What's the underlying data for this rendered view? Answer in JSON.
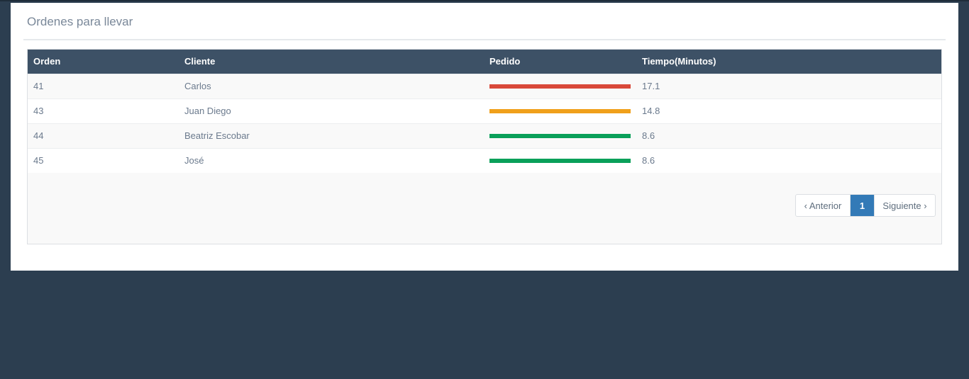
{
  "panel": {
    "title": "Ordenes para llevar"
  },
  "table": {
    "headers": [
      "Orden",
      "Cliente",
      "Pedido",
      "Tiempo(Minutos)"
    ],
    "rows": [
      {
        "orden": "41",
        "cliente": "Carlos",
        "pedido_color": "#d9493a",
        "tiempo": "17.1"
      },
      {
        "orden": "43",
        "cliente": "Juan Diego",
        "pedido_color": "#f0a01b",
        "tiempo": "14.8"
      },
      {
        "orden": "44",
        "cliente": "Beatriz Escobar",
        "pedido_color": "#0aa05a",
        "tiempo": "8.6"
      },
      {
        "orden": "45",
        "cliente": "José",
        "pedido_color": "#0aa05a",
        "tiempo": "8.6"
      }
    ]
  },
  "pagination": {
    "prev": "‹ Anterior",
    "current": "1",
    "next": "Siguiente ›"
  },
  "colors": {
    "background": "#2c3e50",
    "header": "#3d5166",
    "accent": "#337ab7"
  }
}
